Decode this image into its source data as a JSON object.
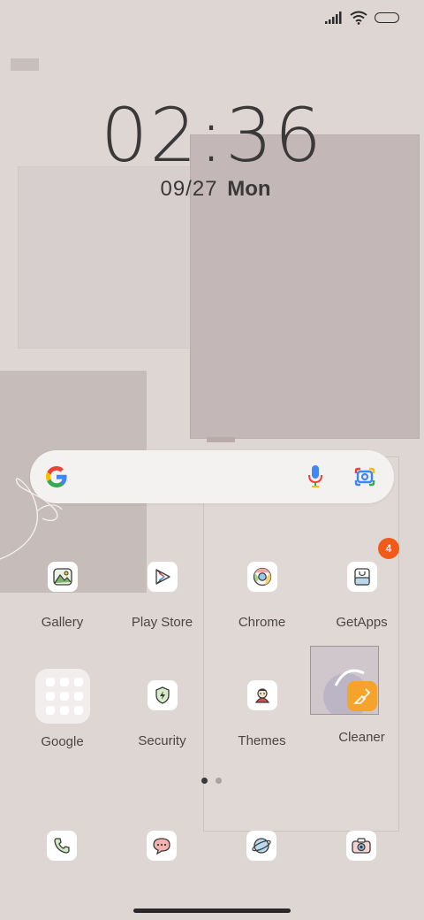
{
  "status_bar": {
    "signal_icon": "signal-icon",
    "wifi_icon": "wifi-icon",
    "battery_icon": "battery-icon"
  },
  "clock": {
    "time": "02:36",
    "date": "09/27",
    "weekday": "Mon"
  },
  "search": {
    "logo": "google-g-icon",
    "mic": "mic-icon",
    "lens": "google-lens-icon"
  },
  "apps": {
    "gallery": {
      "label": "Gallery"
    },
    "play_store": {
      "label": "Play Store"
    },
    "chrome": {
      "label": "Chrome"
    },
    "getapps": {
      "label": "GetApps",
      "badge": "4"
    },
    "google": {
      "label": "Google"
    },
    "security": {
      "label": "Security"
    },
    "themes": {
      "label": "Themes"
    },
    "cleaner": {
      "label": "Cleaner"
    }
  },
  "page_indicator": {
    "pages": 2,
    "current": 1
  },
  "dock": [
    "phone-icon",
    "messages-icon",
    "browser-icon",
    "camera-icon"
  ],
  "colors": {
    "badge": "#f25a1a",
    "cleaner": "#f5a32a",
    "wallpaper": "#ddd6d3"
  }
}
